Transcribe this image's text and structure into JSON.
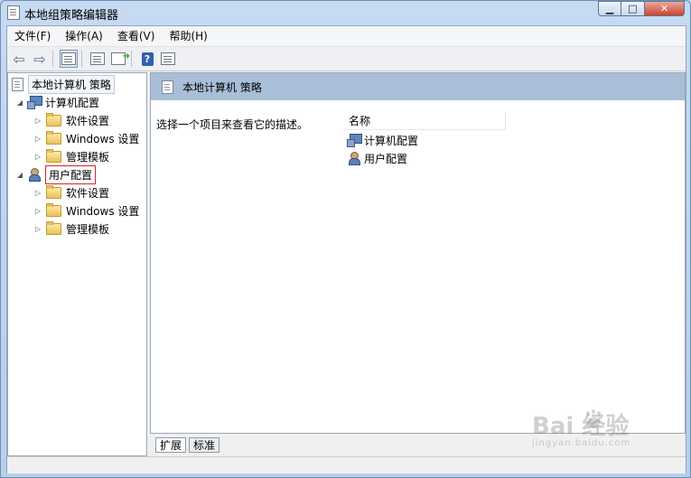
{
  "window": {
    "title": "本地组策略编辑器"
  },
  "menu": [
    "文件(F)",
    "操作(A)",
    "查看(V)",
    "帮助(H)"
  ],
  "tree": {
    "root": "本地计算机 策略",
    "computer": {
      "label": "计算机配置",
      "children": [
        "软件设置",
        "Windows 设置",
        "管理模板"
      ]
    },
    "user": {
      "label": "用户配置",
      "children": [
        "软件设置",
        "Windows 设置",
        "管理模板"
      ]
    }
  },
  "right": {
    "header": "本地计算机 策略",
    "description": "选择一个项目来查看它的描述。",
    "column_name": "名称",
    "items": [
      "计算机配置",
      "用户配置"
    ]
  },
  "tabs": [
    "扩展",
    "标准"
  ],
  "watermark": {
    "main": "Bai  经验",
    "sub": "jingyan.baidu.com"
  }
}
